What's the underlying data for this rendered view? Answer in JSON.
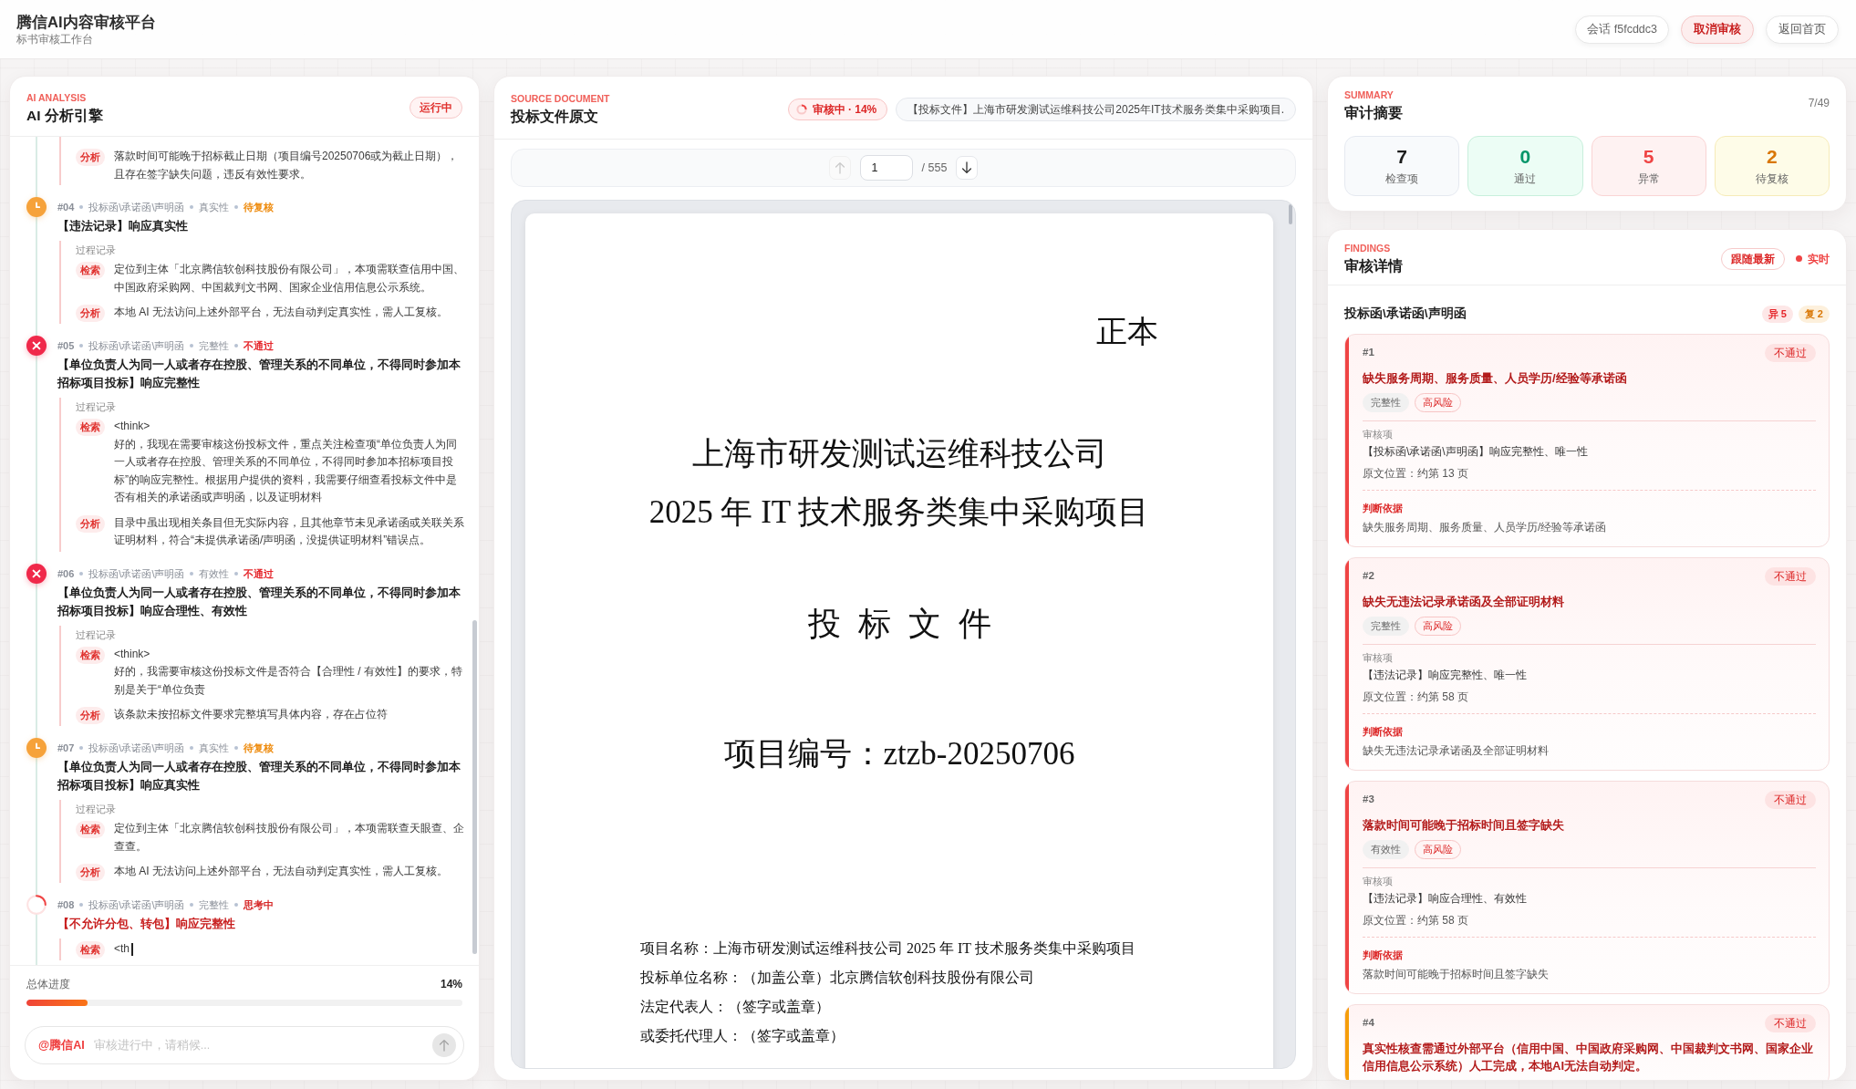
{
  "header": {
    "title": "**腾信AI**内容审核平台",
    "subtitle": "标书审核工作台",
    "session": "会话 f5fcddc3",
    "buttons": [
      {
        "label": "取消审核",
        "kind": "danger"
      },
      {
        "label": "返回首页",
        "kind": "plain"
      }
    ]
  },
  "analysis_panel": {
    "eyebrow": "AI ANALYSIS",
    "title": "AI 分析引擎",
    "status": "运行中",
    "continued_steps": [
      {
        "tag": "分析",
        "text": "落款时间可能晚于招标截止日期（项目编号20250706或为截止日期），且存在签字缺失问题，违反有效性要求。",
        "typing": false
      }
    ],
    "items": [
      {
        "kind": "review",
        "number": "#04",
        "category": "投标函\\承诺函\\声明函",
        "dimension": "真实性",
        "status": "待复核",
        "title": "【违法记录】响应真实性",
        "process_label": "过程记录",
        "steps": [
          {
            "tag": "检索",
            "text": "定位到主体「北京腾信软创科技股份有限公司」，本项需联查信用中国、中国政府采购网、中国裁判文书网、国家企业信用信息公示系统。",
            "typing": false
          },
          {
            "tag": "分析",
            "text": "本地 AI 无法访问上述外部平台，无法自动判定真实性，需人工复核。",
            "typing": false
          }
        ]
      },
      {
        "kind": "fail",
        "number": "#05",
        "category": "投标函\\承诺函\\声明函",
        "dimension": "完整性",
        "status": "不通过",
        "title": "【单位负责人为同一人或者存在控股、管理关系的不同单位，不得同时参加本招标项目投标】响应完整性",
        "process_label": "过程记录",
        "steps": [
          {
            "tag": "检索",
            "text": "<think>\n好的，我现在需要审核这份投标文件，重点关注检查项“单位负责人为同一人或者存在控股、管理关系的不同单位，不得同时参加本招标项目投标”的响应完整性。根据用户提供的资料，我需要仔细查看投标文件中是否有相关的承诺函或声明函，以及证明材料",
            "typing": false
          },
          {
            "tag": "分析",
            "text": "目录中虽出现相关条目但无实际内容，且其他章节未见承诺函或关联关系证明材料，符合“未提供承诺函/声明函，没提供证明材料”错误点。",
            "typing": false
          }
        ]
      },
      {
        "kind": "fail",
        "number": "#06",
        "category": "投标函\\承诺函\\声明函",
        "dimension": "有效性",
        "status": "不通过",
        "title": "【单位负责人为同一人或者存在控股、管理关系的不同单位，不得同时参加本招标项目投标】响应合理性、有效性",
        "process_label": "过程记录",
        "steps": [
          {
            "tag": "检索",
            "text": "<think>\n好的，我需要审核这份投标文件是否符合【合理性 / 有效性】的要求，特别是关于“单位负责",
            "typing": false
          },
          {
            "tag": "分析",
            "text": "该条款未按招标文件要求完整填写具体内容，存在占位符",
            "typing": false
          }
        ]
      },
      {
        "kind": "review",
        "number": "#07",
        "category": "投标函\\承诺函\\声明函",
        "dimension": "真实性",
        "status": "待复核",
        "title": "【单位负责人为同一人或者存在控股、管理关系的不同单位，不得同时参加本招标项目投标】响应真实性",
        "process_label": "过程记录",
        "steps": [
          {
            "tag": "检索",
            "text": "定位到主体「北京腾信软创科技股份有限公司」，本项需联查天眼查、企查查。",
            "typing": false
          },
          {
            "tag": "分析",
            "text": "本地 AI 无法访问上述外部平台，无法自动判定真实性，需人工复核。",
            "typing": false
          }
        ]
      },
      {
        "kind": "thinking",
        "number": "#08",
        "category": "投标函\\承诺函\\声明函",
        "dimension": "完整性",
        "status": "思考中",
        "title": "【不允许分包、转包】响应完整性",
        "steps": [
          {
            "tag": "检索",
            "text": "<th",
            "typing": true
          }
        ]
      }
    ],
    "progress": {
      "label": "总体进度",
      "reading": "14%",
      "level": 0.14
    },
    "composer": {
      "mention": "@腾信AI",
      "placeholder": "审核进行中，请稍候...",
      "send_disabled": true
    }
  },
  "document_panel": {
    "eyebrow": "SOURCE DOCUMENT",
    "title": "投标文件原文",
    "status": "审核中 · 14%",
    "file_name": "【投标文件】上海市研发测试运维科技公司2025年IT技术服务类集中采购项目.",
    "pager": {
      "page": "1",
      "total": "/ 555",
      "prev_disabled": true,
      "next_disabled": false
    },
    "page": {
      "mark": "正本",
      "title_lines": [
        "上海市研发测试运维科技公司",
        "2025 年 IT 技术服务类集中采购项目"
      ],
      "doc_type": "投 标 文 件",
      "project_no": "项目编号：ztzb-20250706",
      "info_lines": [
        "项目名称：上海市研发测试运维科技公司 2025 年 IT 技术服务类集中采购项目",
        "投标单位名称：（加盖公章）北京腾信软创科技股份有限公司",
        "法定代表人：（签字或盖章）",
        "或委托代理人：（签字或盖章）"
      ]
    }
  },
  "summary_panel": {
    "eyebrow": "SUMMARY",
    "title": "审计摘要",
    "count": "7/49",
    "stats": [
      {
        "value": "7",
        "label": "检查项",
        "kind": "total"
      },
      {
        "value": "0",
        "label": "通过",
        "kind": "pass"
      },
      {
        "value": "5",
        "label": "异常",
        "kind": "fail"
      },
      {
        "value": "2",
        "label": "待复核",
        "kind": "review"
      }
    ]
  },
  "findings_panel": {
    "eyebrow": "FINDINGS",
    "title": "审核详情",
    "follow_button": "跟随最新",
    "live_label": "实时",
    "group": {
      "title": "投标函\\承诺函\\声明函",
      "counts": [
        {
          "label": "异 5",
          "kind": "fail"
        },
        {
          "label": "复 2",
          "kind": "review"
        }
      ],
      "items": [
        {
          "number": "#1",
          "status": "不通过",
          "color": "#ef4444",
          "title": "缺失服务周期、服务质量、人员学历/经验等承诺函",
          "tags": [
            {
              "label": "完整性",
              "kind": "dimension"
            },
            {
              "label": "高风险",
              "kind": "risk"
            }
          ],
          "check_label": "审核项",
          "check_item": "【投标函\\承诺函\\声明函】响应完整性、唯一性",
          "location": "原文位置：约第 13 页",
          "basis_label": "判断依据",
          "basis": "缺失服务周期、服务质量、人员学历/经验等承诺函"
        },
        {
          "number": "#2",
          "status": "不通过",
          "color": "#ef4444",
          "title": "缺失无违法记录承诺函及全部证明材料",
          "tags": [
            {
              "label": "完整性",
              "kind": "dimension"
            },
            {
              "label": "高风险",
              "kind": "risk"
            }
          ],
          "check_label": "审核项",
          "check_item": "【违法记录】响应完整性、唯一性",
          "location": "原文位置：约第 58 页",
          "basis_label": "判断依据",
          "basis": "缺失无违法记录承诺函及全部证明材料"
        },
        {
          "number": "#3",
          "status": "不通过",
          "color": "#ef4444",
          "title": "落款时间可能晚于招标时间且签字缺失",
          "tags": [
            {
              "label": "有效性",
              "kind": "dimension"
            },
            {
              "label": "高风险",
              "kind": "risk"
            }
          ],
          "check_label": "审核项",
          "check_item": "【违法记录】响应合理性、有效性",
          "location": "原文位置：约第 58 页",
          "basis_label": "判断依据",
          "basis": "落款时间可能晚于招标时间且签字缺失"
        },
        {
          "number": "#4",
          "status": "不通过",
          "color": "#f59e0b",
          "title": "真实性核查需通过外部平台（信用中国、中国政府采购网、中国裁判文书网、国家企业信用信息公示系统）人工完成，本地AI无法自动判定。"
        }
      ]
    }
  }
}
